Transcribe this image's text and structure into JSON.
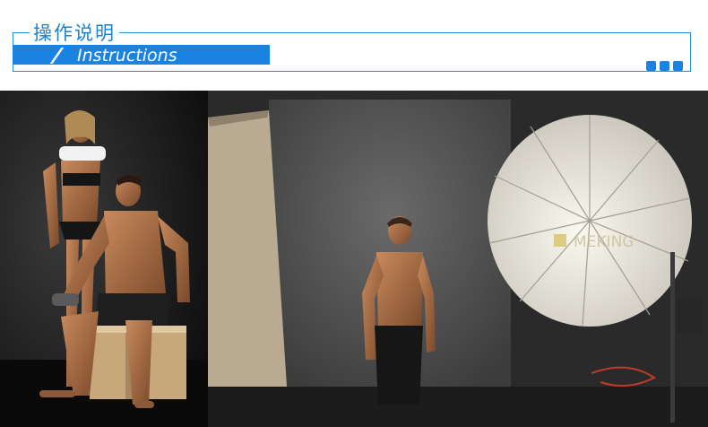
{
  "header": {
    "title_cn": "操作说明",
    "title_en": "Instructions"
  },
  "photo": {
    "watermark": "MEKING",
    "icons": [
      "three-square-dots-icon"
    ]
  },
  "colors": {
    "accent": "#1a82e0",
    "frame": "#2b8fd6",
    "backdrop": "#5a5a5a",
    "umbrella": "#e6e3dc"
  }
}
